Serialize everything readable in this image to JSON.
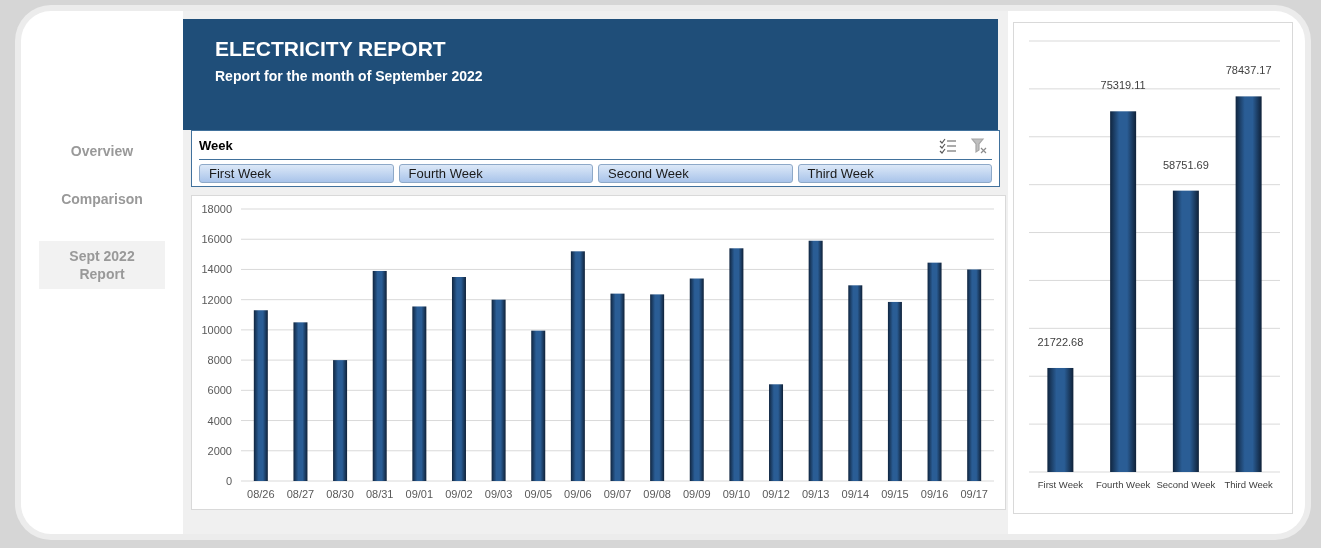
{
  "nav": [
    {
      "label": "Overview",
      "selected": false
    },
    {
      "label": "Comparison",
      "selected": false
    },
    {
      "label": "Sept 2022 Report",
      "selected": true
    }
  ],
  "header": {
    "title": "ELECTRICITY REPORT",
    "subtitle": "Report for the month of September 2022"
  },
  "slicer": {
    "title": "Week",
    "items": [
      {
        "label": "First Week",
        "selected": true
      },
      {
        "label": "Fourth Week",
        "selected": true
      },
      {
        "label": "Second Week",
        "selected": true
      },
      {
        "label": "Third Week",
        "selected": true
      }
    ]
  },
  "daily_chart": {
    "chart_data": {
      "type": "bar",
      "categories": [
        "08/26",
        "08/27",
        "08/30",
        "08/31",
        "09/01",
        "09/02",
        "09/03",
        "09/05",
        "09/06",
        "09/07",
        "09/08",
        "09/09",
        "09/10",
        "09/12",
        "09/13",
        "09/14",
        "09/15",
        "09/16",
        "09/17"
      ],
      "values": [
        11300,
        10500,
        8000,
        13900,
        11550,
        13500,
        12000,
        9950,
        15200,
        12400,
        12350,
        13400,
        15400,
        6400,
        15900,
        12950,
        11850,
        14450,
        14000
      ],
      "grid": true,
      "ylim": [
        0,
        18000
      ],
      "yticks": [
        0,
        2000,
        4000,
        6000,
        8000,
        10000,
        12000,
        14000,
        16000,
        18000
      ]
    }
  },
  "weekly_chart": {
    "chart_data": {
      "type": "bar",
      "categories": [
        "First Week",
        "Fourth Week",
        "Second Week",
        "Third Week"
      ],
      "values": [
        21722.68,
        75319.11,
        58751.69,
        78437.17
      ],
      "value_labels": [
        "21722.68",
        "75319.11",
        "58751.69",
        "78437.17"
      ],
      "grid": true,
      "ylim": [
        0,
        90000
      ]
    }
  }
}
